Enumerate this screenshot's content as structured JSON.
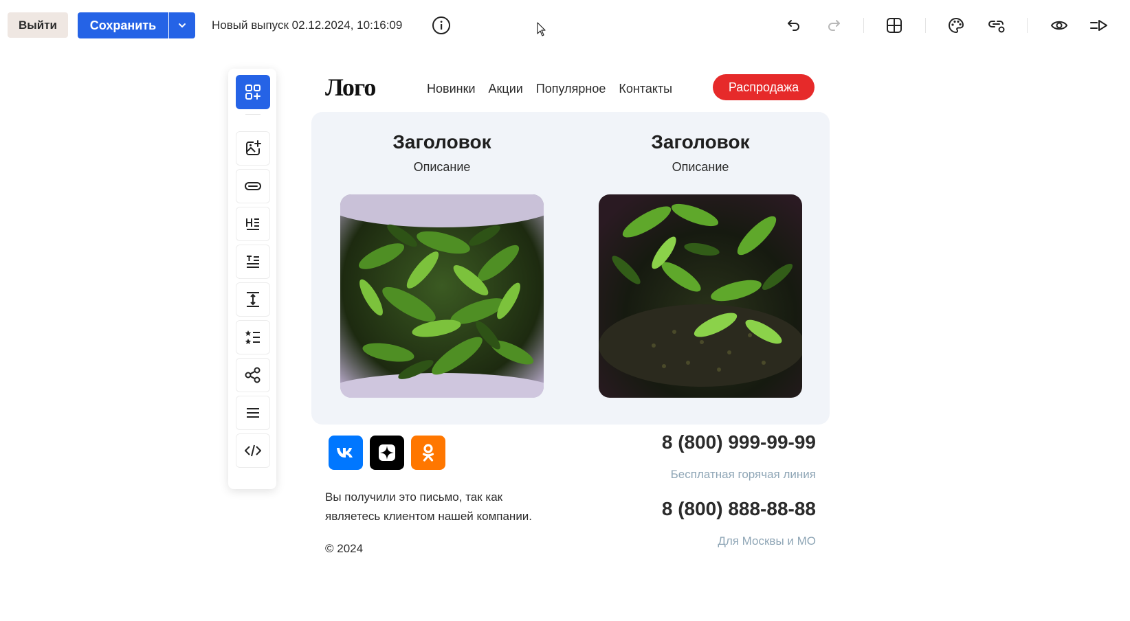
{
  "toolbar": {
    "exit_label": "Выйти",
    "save_label": "Сохранить",
    "issue_title": "Новый выпуск 02.12.2024, 10:16:09",
    "actions": [
      "undo-icon",
      "redo-icon",
      "layout-icon",
      "palette-icon",
      "link-settings-icon",
      "preview-icon",
      "send-test-icon"
    ]
  },
  "block_panel": {
    "items": [
      "blocks-icon",
      "image-add-icon",
      "button-icon",
      "heading-icon",
      "text-icon",
      "spacer-icon",
      "list-icon",
      "share-icon",
      "menu-icon",
      "code-icon"
    ],
    "active_item": "blocks-icon"
  },
  "email": {
    "logo": "Лого",
    "nav": [
      "Новинки",
      "Акции",
      "Популярное",
      "Контакты"
    ],
    "sale_button": "Распродажа",
    "cards": [
      {
        "title": "Заголовок",
        "description": "Описание",
        "image": "green tea leaves in bowl"
      },
      {
        "title": "Заголовок",
        "description": "Описание",
        "image": "green tea leaves and dry tea"
      }
    ],
    "social": [
      "vk-icon",
      "zen-icon",
      "ok-icon"
    ],
    "unsubscribe_text": "Вы получили это письмо, так как являетесь клиентом нашей компании.",
    "copyright": "© 2024",
    "phones": [
      {
        "number": "8 (800) 999-99-99",
        "note": "Бесплатная горячая линия"
      },
      {
        "number": "8 (800) 888-88-88",
        "note": "Для Москвы и МО"
      }
    ]
  },
  "colors": {
    "primary": "#2563e6",
    "sale": "#e62a2a",
    "cards_bg": "#f1f4f9",
    "muted": "#8fa6b6",
    "vk": "#0077ff",
    "zen": "#000000",
    "ok": "#ff7700"
  }
}
